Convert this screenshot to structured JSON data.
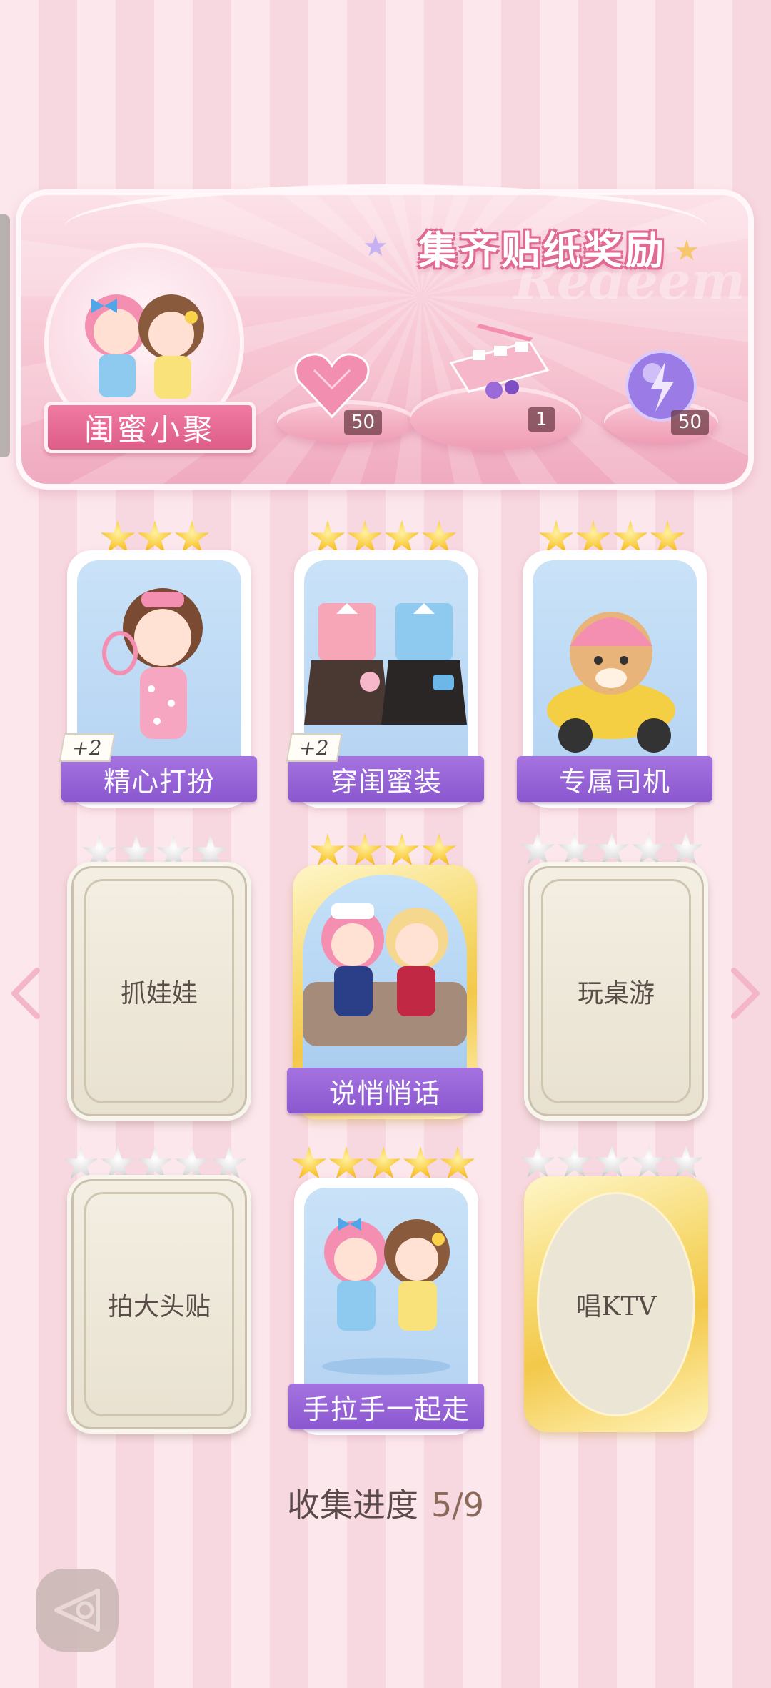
{
  "banner": {
    "title": "集齐贴纸奖励",
    "watermark": "Redeem",
    "plaque": "闺蜜小聚",
    "rewards": [
      {
        "icon": "pink-heart-gem-icon",
        "count": "50"
      },
      {
        "icon": "gift-box-icon",
        "count": "1"
      },
      {
        "icon": "purple-energy-orb-icon",
        "count": "50"
      }
    ]
  },
  "cards": [
    {
      "label": "精心打扮",
      "state": "collected",
      "stars": 3,
      "plus": "+2"
    },
    {
      "label": "穿闺蜜装",
      "state": "collected",
      "stars": 4,
      "plus": "+2"
    },
    {
      "label": "专属司机",
      "state": "collected",
      "stars": 4
    },
    {
      "label": "抓娃娃",
      "state": "locked",
      "stars": 4
    },
    {
      "label": "说悄悄话",
      "state": "collected-gold",
      "stars": 4
    },
    {
      "label": "玩桌游",
      "state": "locked",
      "stars": 5
    },
    {
      "label": "拍大头贴",
      "state": "locked",
      "stars": 5
    },
    {
      "label": "手拉手一起走",
      "state": "collected",
      "stars": 5
    },
    {
      "label": "唱KTV",
      "state": "locked-gold",
      "stars": 5
    }
  ],
  "progress": {
    "label": "收集进度",
    "value": "5/9"
  },
  "colors": {
    "ribbon": "#9a66d8",
    "gold_star": "#f9c93a",
    "grey_star": "#d3d3d3",
    "pink_bg": "#fce7ec"
  }
}
